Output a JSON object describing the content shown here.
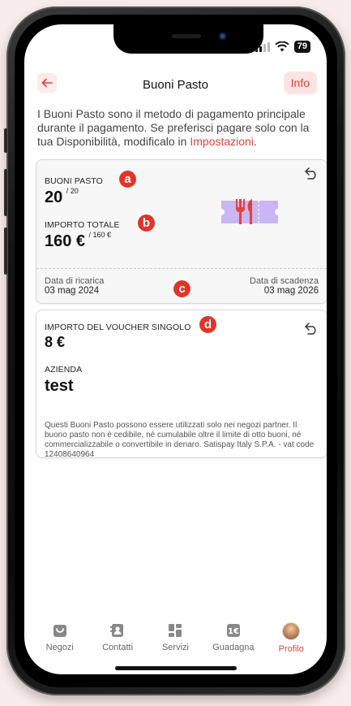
{
  "status_bar": {
    "battery": "79"
  },
  "header": {
    "title": "Buoni Pasto",
    "info_label": "Info"
  },
  "intro": {
    "text": "I Buoni Pasto sono il metodo di pagamento principale durante il pagamento. Se preferisci pagare solo con la tua Disponibilità, modificalo in ",
    "link": "Impostazioni",
    "suffix": "."
  },
  "voucher_card": {
    "buoni_label": "BUONI PASTO",
    "buoni_value": "20",
    "buoni_total": "/ 20",
    "importo_label": "IMPORTO TOTALE",
    "importo_value": "160 €",
    "importo_total": "/ 160 €",
    "ricarica_label": "Data di ricarica",
    "ricarica_date": "03 mag 2024",
    "scadenza_label": "Data di scadenza",
    "scadenza_date": "03 mag 2026"
  },
  "detail_card": {
    "voucher_label": "IMPORTO DEL VOUCHER SINGOLO",
    "voucher_value": "8 €",
    "azienda_label": "AZIENDA",
    "azienda_value": "test",
    "disclaimer": "Questi Buoni Pasto possono essere utilizzati solo nei negozi partner. Il buono pasto non è cedibile, né cumulabile oltre il limite di otto buoni, né commercializzabile o convertibile in denaro. Satispay Italy S.P.A. - vat code 12408640964"
  },
  "markers": {
    "a": "a",
    "b": "b",
    "c": "c",
    "d": "d"
  },
  "nav": [
    {
      "label": "Negozi",
      "icon": "shop-icon"
    },
    {
      "label": "Contatti",
      "icon": "contacts-icon"
    },
    {
      "label": "Servizi",
      "icon": "services-icon"
    },
    {
      "label": "Guadagna",
      "icon": "cashback-icon"
    },
    {
      "label": "Profilo",
      "icon": "avatar"
    }
  ],
  "colors": {
    "accent": "#e0433a",
    "accent_bg": "#fde4e2",
    "marker": "#e0352a",
    "voucher_icon_bg": "#c9b6f2",
    "page_bg": "#f9ecec"
  }
}
